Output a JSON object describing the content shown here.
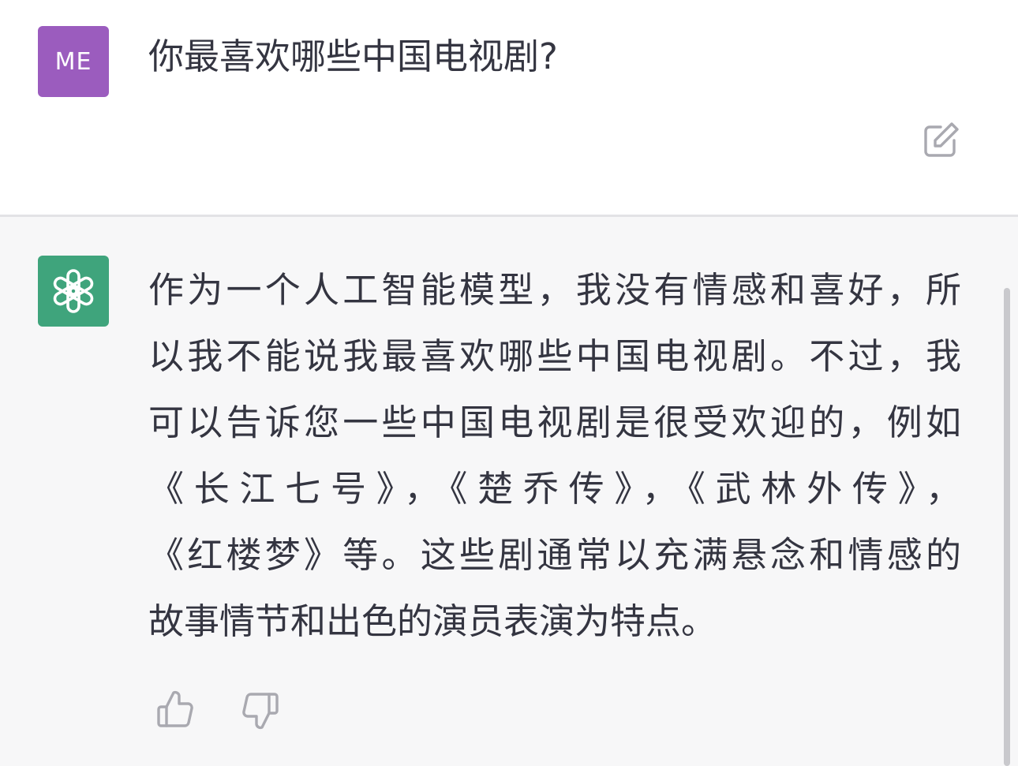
{
  "user": {
    "avatar_initials": "ME",
    "avatar_color": "#9b5cbe",
    "message": "你最喜欢哪些中国电视剧?"
  },
  "assistant": {
    "avatar_icon": "openai-logo-icon",
    "avatar_color": "#3fa47c",
    "lines": [
      "作为一个人工智能模型，我没有情感和喜好，所",
      "以我不能说我最喜欢哪些中国电视剧。不过，我",
      "可以告诉您一些中国电视剧是很受欢迎的，例如",
      "《长江七号》，《楚乔传》，《武林外传》，",
      "《红楼梦》等。这些剧通常以充满悬念和情感的",
      "故事情节和出色的演员表演为特点。"
    ]
  },
  "icons": {
    "edit": "edit-icon",
    "thumbs_up": "thumbs-up-icon",
    "thumbs_down": "thumbs-down-icon"
  },
  "colors": {
    "text": "#343541",
    "assistant_background": "#f7f7f8",
    "icon_gray": "#a9a9b0"
  }
}
